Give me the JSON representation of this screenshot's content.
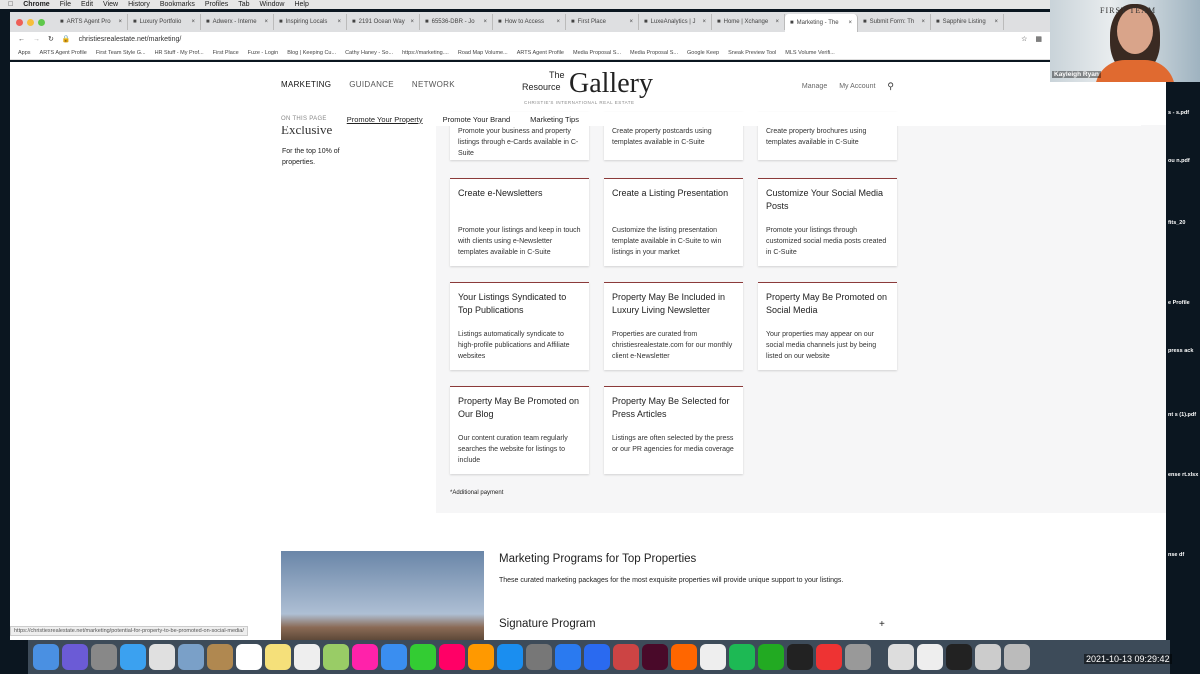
{
  "menubar": {
    "items": [
      "Chrome",
      "File",
      "Edit",
      "View",
      "History",
      "Bookmarks",
      "Profiles",
      "Tab",
      "Window",
      "Help"
    ]
  },
  "tabs": [
    {
      "label": "ARTS Agent Pro"
    },
    {
      "label": "Luxury Portfolio"
    },
    {
      "label": "Adwerx - Interne"
    },
    {
      "label": "Inspiring Locals"
    },
    {
      "label": "2191 Ocean Way"
    },
    {
      "label": "65536-DBR - Jo"
    },
    {
      "label": "How to Access"
    },
    {
      "label": "First Place"
    },
    {
      "label": "LuxeAnalytics | J"
    },
    {
      "label": "Home | Xchange"
    },
    {
      "label": "Marketing - The",
      "active": true
    },
    {
      "label": "Submit Form: Th"
    },
    {
      "label": "Sapphire Listing"
    }
  ],
  "address": {
    "url": "christiesrealestate.net/marketing/"
  },
  "bookmarks": [
    "Apps",
    "ARTS Agent Profile",
    "First Team Style G...",
    "HR Stuff - My Prof...",
    "First Place",
    "Fuze - Login",
    "Blog | Keeping Cu...",
    "Cathy Haney - So...",
    "https://marketing....",
    "Road Map Volume...",
    "ARTS Agent Profile",
    "Media Proposal S...",
    "Media Proposal S...",
    "Google Keep",
    "Sneak Preview Tool",
    "MLS Volume Verifi..."
  ],
  "site": {
    "nav": [
      "MARKETING",
      "GUIDANCE",
      "NETWORK"
    ],
    "logo": {
      "the": "The",
      "resource": "Resource",
      "gallery": "Gallery",
      "sub": "CHRISTIE'S INTERNATIONAL REAL ESTATE"
    },
    "right_nav": {
      "manage": "Manage",
      "account": "My Account"
    },
    "on_this_page": {
      "label": "ON THIS PAGE",
      "links": [
        "Promote Your Property",
        "Promote Your Brand",
        "Marketing Tips"
      ]
    },
    "sidebar": {
      "title": "Exclusive",
      "text": "For the top 10% of properties."
    },
    "cards_partial": [
      {
        "desc": "Promote your business and property listings through e-Cards available in C-Suite"
      },
      {
        "desc": "Create property postcards using templates available in C-Suite"
      },
      {
        "desc": "Create property brochures using templates available in C-Suite"
      }
    ],
    "cards": [
      {
        "title": "Create e-Newsletters",
        "desc": "Promote your listings and keep in touch with clients using e-Newsletter templates available in C-Suite"
      },
      {
        "title": "Create a Listing Presentation",
        "desc": "Customize the listing presentation template available in C-Suite to win listings in your market"
      },
      {
        "title": "Customize Your Social Media Posts",
        "desc": "Promote your listings through customized social media posts created in C-Suite"
      },
      {
        "title": "Your Listings Syndicated to Top Publications",
        "desc": "Listings automatically syndicate to high-profile publications and Affiliate websites"
      },
      {
        "title": "Property May Be Included in Luxury Living Newsletter",
        "desc": "Properties are curated from christiesrealestate.com for our monthly client e-Newsletter"
      },
      {
        "title": "Property May Be Promoted on Social Media",
        "desc": "Your properties may appear on our social media channels just by being listed on our website"
      },
      {
        "title": "Property May Be Promoted on Our Blog",
        "desc": "Our content curation team regularly searches the website for listings to include"
      },
      {
        "title": "Property May Be Selected for Press Articles",
        "desc": "Listings are often selected by the press or our PR agencies for media coverage"
      }
    ],
    "additional": "*Additional payment",
    "programs": {
      "title": "Marketing Programs for Top Properties",
      "desc": "These curated marketing packages for the most exquisite properties will provide unique support to your listings.",
      "signature": "Signature Program",
      "expand": "+"
    }
  },
  "status_url": "https://christiesrealestate.net/marketing/potential-for-property-to-be-promoted-on-social-media/",
  "webcam": {
    "name": "Kayleigh Ryan",
    "brand": "FIRST TEAM"
  },
  "desktop_files": [
    "s - s.pdf",
    "ou n.pdf",
    "fits_20",
    "e Profile",
    "press ack",
    "nt s (1).pdf",
    "ense rt.xlsx",
    "nse df"
  ],
  "clock": "2021-10-13  09:29:42",
  "colors": {
    "card_accent": "#8b3a3a",
    "grey_panel": "#f6f6f7"
  }
}
